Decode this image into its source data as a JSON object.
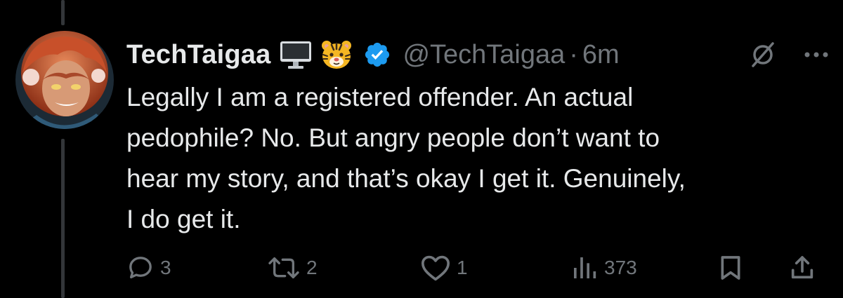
{
  "tweet": {
    "display_name": "TechTaigaa",
    "name_emojis": [
      "desktop-computer-icon",
      "tiger-face-icon"
    ],
    "verified": true,
    "handle": "@TechTaigaa",
    "separator": "·",
    "time": "6m",
    "text": "Legally I am a registered offender. An actual\npedophile? No. But angry people don’t want to\nhear my story, and that’s okay I get it. Genuinely,\nI do get it."
  },
  "actions": {
    "replies": "3",
    "reposts": "2",
    "likes": "1",
    "views": "373"
  },
  "colors": {
    "background": "#000000",
    "text": "#e7e9ea",
    "muted": "#71767b",
    "verified_badge": "#1d9bf0",
    "thread_line": "#333639"
  }
}
